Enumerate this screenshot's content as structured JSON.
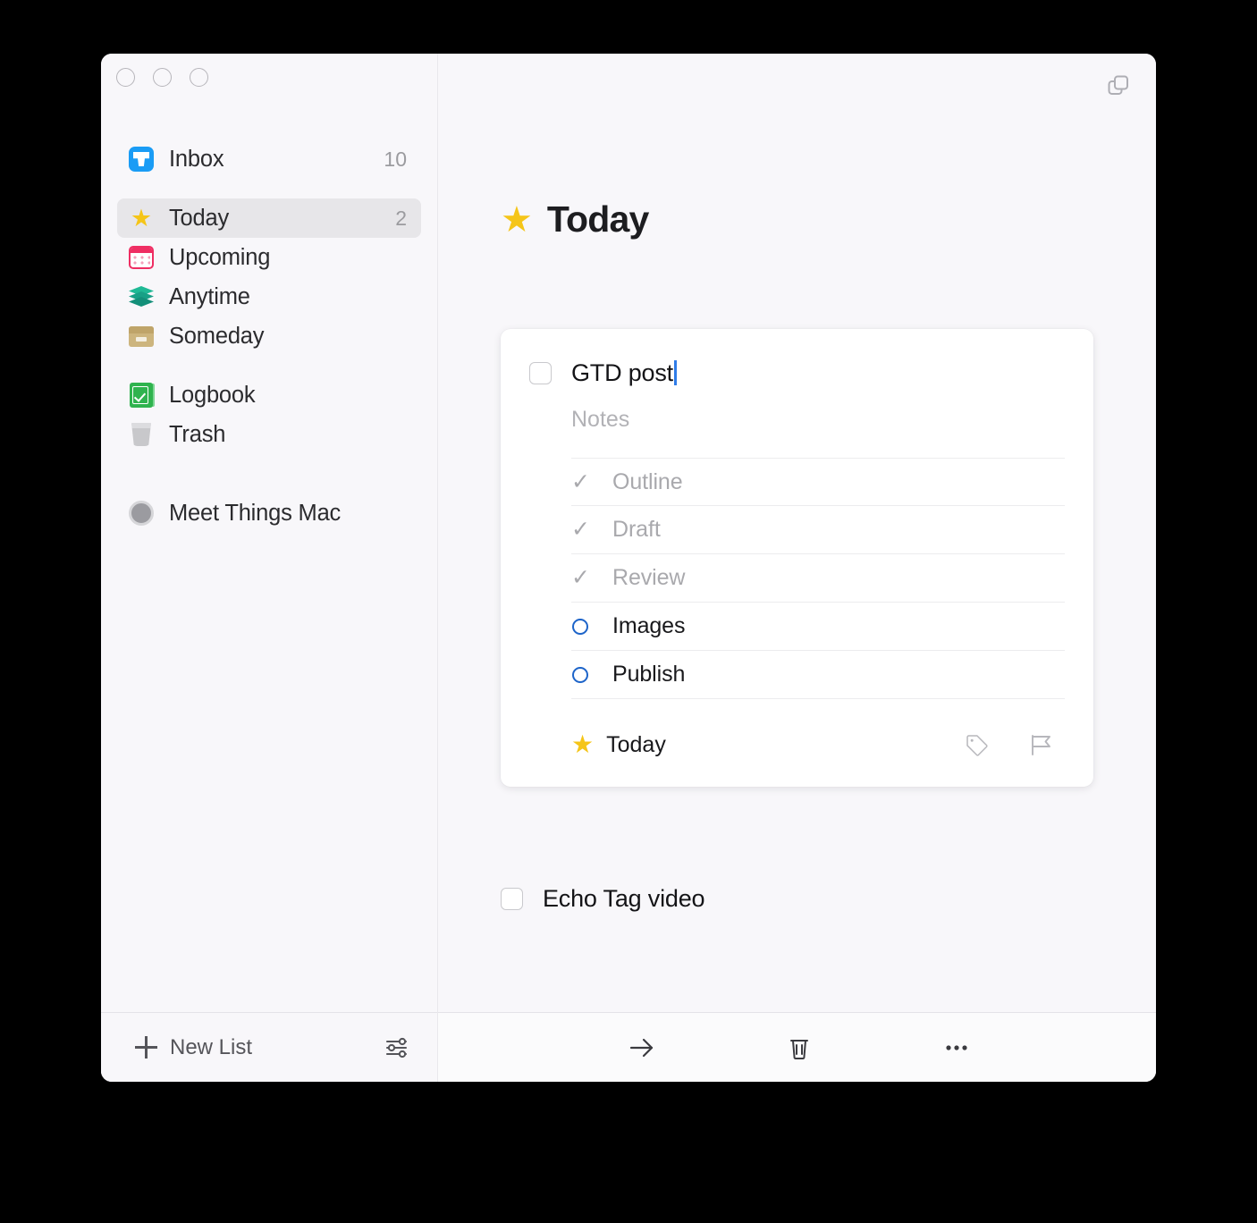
{
  "window": {
    "traffic_lights": [
      "close",
      "minimize",
      "zoom"
    ]
  },
  "sidebar": {
    "items": [
      {
        "id": "inbox",
        "icon": "inbox-icon",
        "label": "Inbox",
        "count": "10",
        "selected": false
      },
      {
        "id": "today",
        "icon": "star-icon",
        "label": "Today",
        "count": "2",
        "selected": true
      },
      {
        "id": "upcoming",
        "icon": "calendar-icon",
        "label": "Upcoming",
        "count": "",
        "selected": false
      },
      {
        "id": "anytime",
        "icon": "layers-icon",
        "label": "Anytime",
        "count": "",
        "selected": false
      },
      {
        "id": "someday",
        "icon": "archive-box-icon",
        "label": "Someday",
        "count": "",
        "selected": false
      },
      {
        "id": "logbook",
        "icon": "logbook-icon",
        "label": "Logbook",
        "count": "",
        "selected": false
      },
      {
        "id": "trash",
        "icon": "trash-icon",
        "label": "Trash",
        "count": "",
        "selected": false
      },
      {
        "id": "meet",
        "icon": "gray-circle-icon",
        "label": "Meet Things Mac",
        "count": "",
        "selected": false
      }
    ],
    "footer": {
      "new_list_label": "New List",
      "filter_icon": "sliders-icon"
    }
  },
  "main": {
    "duplicate_icon": "duplicate-window-icon",
    "page_title": "Today",
    "page_title_icon": "star-icon",
    "task_card": {
      "title": "GTD post",
      "title_has_cursor": true,
      "notes_placeholder": "Notes",
      "checklist": [
        {
          "label": "Outline",
          "state": "done"
        },
        {
          "label": "Draft",
          "state": "done"
        },
        {
          "label": "Review",
          "state": "done"
        },
        {
          "label": "Images",
          "state": "todo"
        },
        {
          "label": "Publish",
          "state": "todo"
        }
      ],
      "when_label": "Today",
      "when_icon": "star-icon",
      "actions": [
        "tag-icon",
        "flag-icon"
      ]
    },
    "tasks": [
      {
        "label": "Echo Tag video",
        "completed": false
      }
    ],
    "footer_actions": [
      "move-arrow-icon",
      "trash-icon",
      "more-options-icon"
    ]
  },
  "colors": {
    "accent_blue": "#1d64c9",
    "star_yellow": "#f5c518",
    "inbox_blue": "#1a9cf5",
    "calendar_pink": "#ef2e63",
    "anytime_teal": "#18a086",
    "someday_tan": "#cdb57e",
    "logbook_green": "#2fb34e",
    "cursor_blue": "#2f7ce8",
    "selected_row_bg": "#e7e6e9",
    "window_bg": "#f8f7fa",
    "card_bg": "#ffffff"
  }
}
